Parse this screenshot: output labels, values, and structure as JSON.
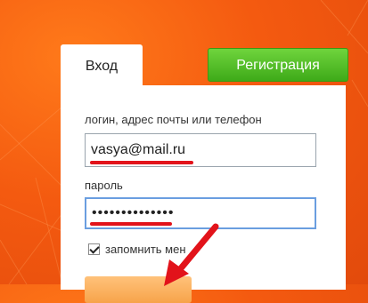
{
  "tabs": {
    "login_label": "Вход",
    "register_label": "Регистрация"
  },
  "form": {
    "login_label": "логин, адрес почты или телефон",
    "login_value": "vasya@mail.ru",
    "password_label": "пароль",
    "password_value": "••••••••••••••",
    "remember_label": "запомнить мен"
  },
  "colors": {
    "background": "#f45a10",
    "register_button": "#3eaa19",
    "annotation": "#e2131a",
    "submit_button": "#f7a34a"
  },
  "icons": {
    "annotation_arrow": "red-arrow-icon",
    "checkbox": "checkbox-checked-icon"
  }
}
